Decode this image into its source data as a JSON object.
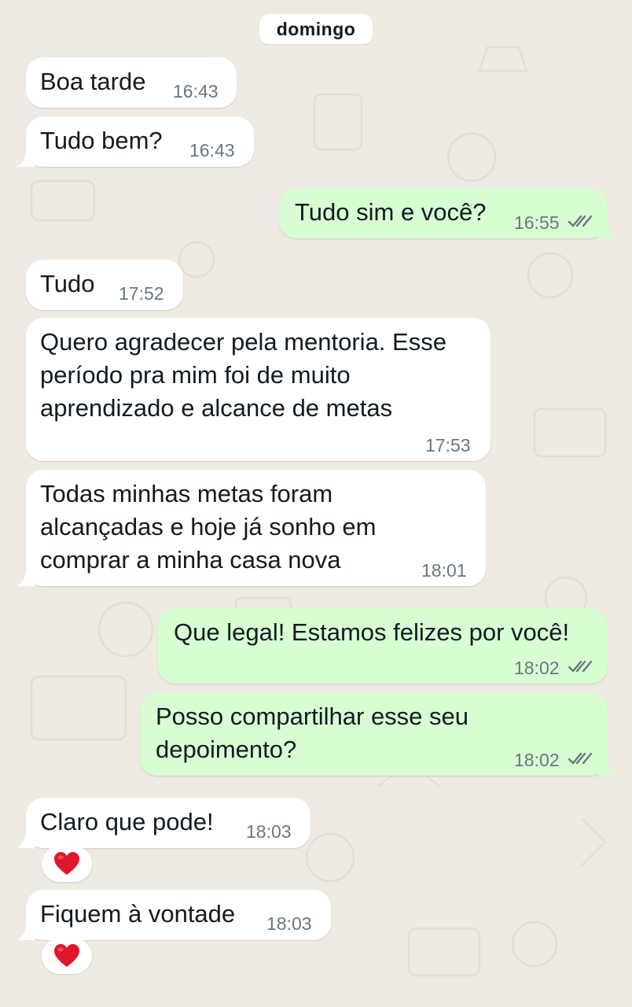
{
  "chat": {
    "day_label": "domingo",
    "messages": [
      {
        "text": "Boa tarde",
        "time": "16:43",
        "direction": "incoming"
      },
      {
        "text": "Tudo bem?",
        "time": "16:43",
        "direction": "incoming"
      },
      {
        "text": "Tudo sim e você?",
        "time": "16:55",
        "direction": "outgoing",
        "status": "read"
      },
      {
        "text": "Tudo",
        "time": "17:52",
        "direction": "incoming"
      },
      {
        "text": "Quero agradecer pela mentoria. Esse\nperíodo pra mim foi de muito\naprendizado e alcance de metas",
        "time": "17:53",
        "direction": "incoming"
      },
      {
        "text": "Todas minhas metas foram\nalcançadas e hoje já sonho em\ncomprar a minha casa nova",
        "time": "18:01",
        "direction": "incoming"
      },
      {
        "text": "Que legal! Estamos felizes por você!",
        "time": "18:02",
        "direction": "outgoing",
        "status": "read"
      },
      {
        "text": "Posso compartilhar esse seu\ndepoimento?",
        "time": "18:02",
        "direction": "outgoing",
        "status": "read"
      },
      {
        "text": "Claro que pode!",
        "time": "18:03",
        "direction": "incoming",
        "reaction": "heart"
      },
      {
        "text": "Fiquem à vontade",
        "time": "18:03",
        "direction": "incoming",
        "reaction": "heart"
      }
    ]
  },
  "colors": {
    "background": "#efeae2",
    "incoming_bubble": "#ffffff",
    "outgoing_bubble": "#d9fdd3",
    "timestamp": "#667781",
    "read_ticks": "#667781",
    "reaction_heart": "#e0162b"
  },
  "icons": {
    "read_status": "double-check-icon",
    "reaction": "red-heart-icon"
  }
}
